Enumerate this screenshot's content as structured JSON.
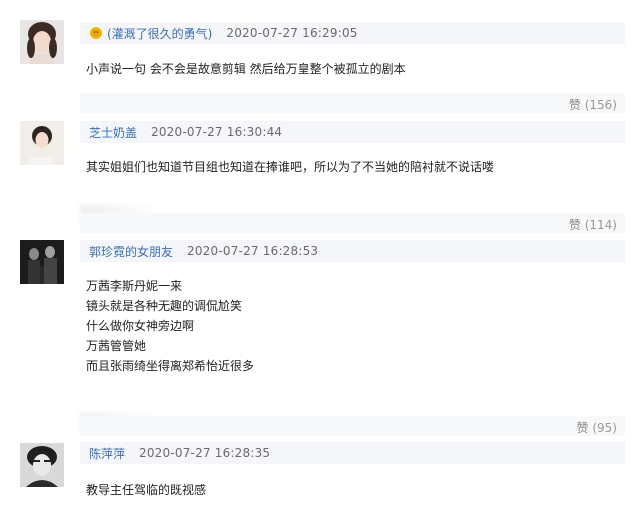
{
  "comments": [
    {
      "username": "(灌溉了很久的勇气)",
      "timestamp": "2020-07-27  16:29:05",
      "lines": [
        "小声说一句 会不会是故意剪辑 然后给万皇整个被孤立的剧本"
      ],
      "like_label": "赞",
      "like_count": "(156)",
      "has_badge": true
    },
    {
      "username": "芝士奶盖",
      "timestamp": "2020-07-27  16:30:44",
      "lines": [
        "其实姐姐们也知道节目组也知道在捧谁吧，所以为了不当她的陪衬就不说话喽"
      ],
      "like_label": "赞",
      "like_count": "(114)"
    },
    {
      "username": "郭珍霓的女朋友",
      "timestamp": "2020-07-27  16:28:53",
      "lines": [
        "万茜李斯丹妮一来",
        "镜头就是各种无趣的调侃尬笑",
        "什么做你女神旁边啊",
        "万茜管管她",
        "而且张雨绮坐得离郑希怡近很多"
      ],
      "like_label": "赞",
      "like_count": "(95)"
    },
    {
      "username": "陈萍萍",
      "timestamp": "2020-07-27  16:28:35",
      "lines": [
        "教导主任驾临的既视感"
      ]
    }
  ],
  "colors": {
    "username": "#3a6fb3",
    "header_bg": "#f4f6f9",
    "text": "#222222"
  }
}
